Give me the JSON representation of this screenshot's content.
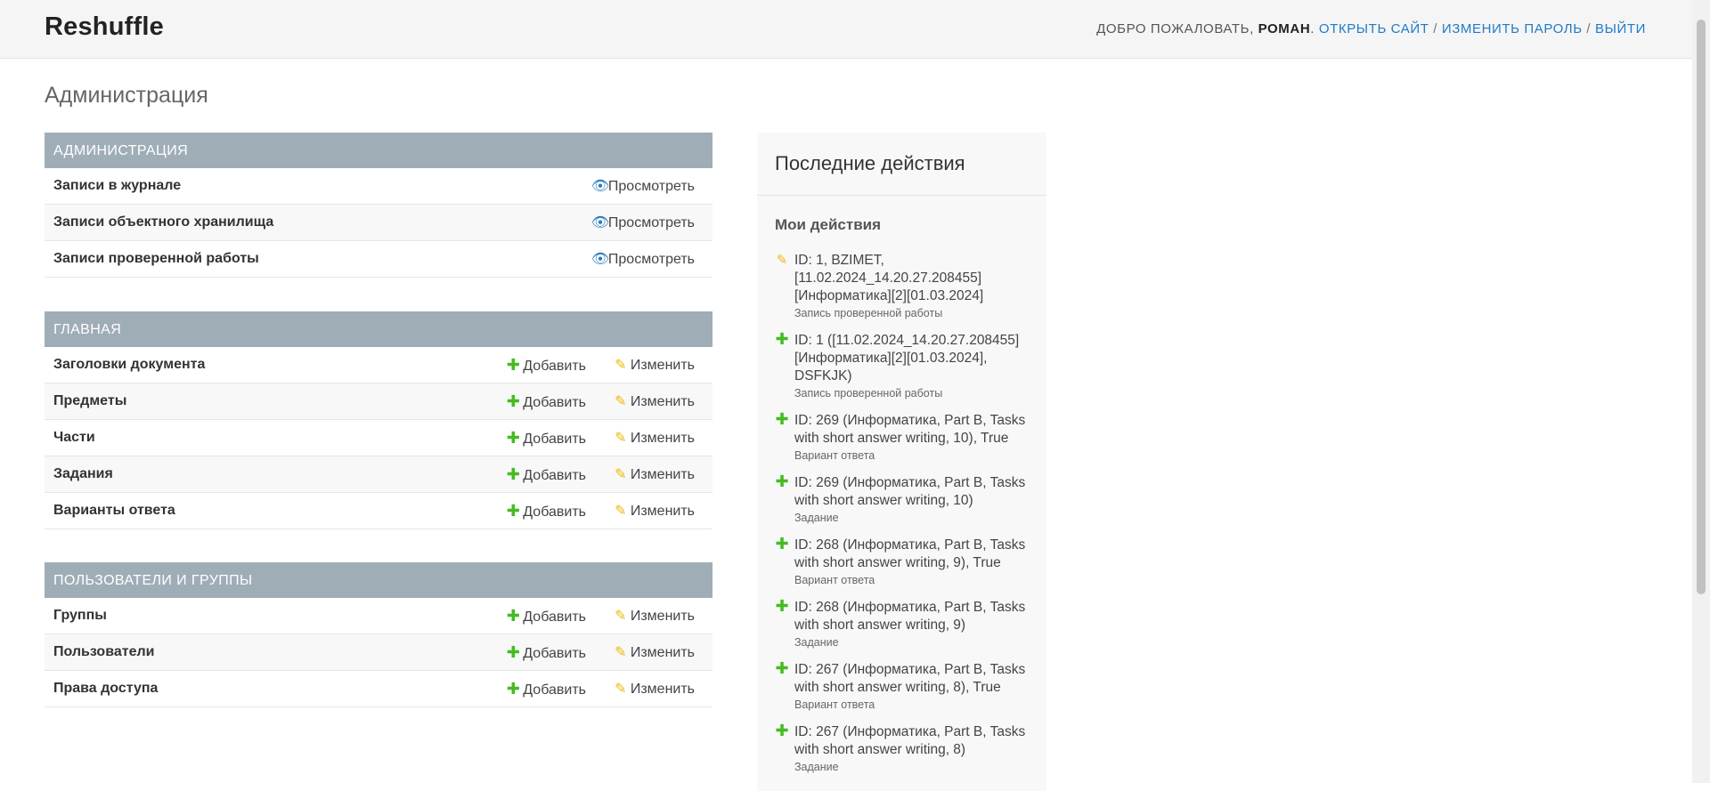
{
  "header": {
    "brand": "Reshuffle",
    "welcome": "Добро пожаловать,",
    "username": "Роман",
    "view_site": "Открыть сайт",
    "change_password": "Изменить пароль",
    "logout": "Выйти",
    "sep": "/"
  },
  "page": {
    "title": "Администрация"
  },
  "modules": [
    {
      "caption": "Администрация",
      "rows": [
        {
          "label": "Записи в журнале",
          "view": "Просмотреть"
        },
        {
          "label": "Записи объектного хранилища",
          "view": "Просмотреть"
        },
        {
          "label": "Записи проверенной работы",
          "view": "Просмотреть"
        }
      ]
    },
    {
      "caption": "Главная",
      "rows": [
        {
          "label": "Заголовки документа",
          "add": "Добавить",
          "change": "Изменить"
        },
        {
          "label": "Предметы",
          "add": "Добавить",
          "change": "Изменить"
        },
        {
          "label": "Части",
          "add": "Добавить",
          "change": "Изменить"
        },
        {
          "label": "Задания",
          "add": "Добавить",
          "change": "Изменить"
        },
        {
          "label": "Варианты ответа",
          "add": "Добавить",
          "change": "Изменить"
        }
      ]
    },
    {
      "caption": "Пользователи и группы",
      "rows": [
        {
          "label": "Группы",
          "add": "Добавить",
          "change": "Изменить"
        },
        {
          "label": "Пользователи",
          "add": "Добавить",
          "change": "Изменить"
        },
        {
          "label": "Права доступа",
          "add": "Добавить",
          "change": "Изменить"
        }
      ]
    }
  ],
  "recent": {
    "title": "Последние действия",
    "subtitle": "Мои действия",
    "actions": [
      {
        "icon": "pencil-icon",
        "text": "ID: 1, BZIMET, [11.02.2024_14.20.27.208455][Информатика][2][01.03.2024]",
        "type": "Запись проверенной работы"
      },
      {
        "icon": "plus-icon",
        "text": "ID: 1 ([11.02.2024_14.20.27.208455][Информатика][2][01.03.2024], DSFKJK)",
        "type": "Запись проверенной работы"
      },
      {
        "icon": "plus-icon",
        "text": "ID: 269 (Информатика, Part B, Tasks with short answer writing, 10), True",
        "type": "Вариант ответа"
      },
      {
        "icon": "plus-icon",
        "text": "ID: 269 (Информатика, Part B, Tasks with short answer writing, 10)",
        "type": "Задание"
      },
      {
        "icon": "plus-icon",
        "text": "ID: 268 (Информатика, Part B, Tasks with short answer writing, 9), True",
        "type": "Вариант ответа"
      },
      {
        "icon": "plus-icon",
        "text": "ID: 268 (Информатика, Part B, Tasks with short answer writing, 9)",
        "type": "Задание"
      },
      {
        "icon": "plus-icon",
        "text": "ID: 267 (Информатика, Part B, Tasks with short answer writing, 8), True",
        "type": "Вариант ответа"
      },
      {
        "icon": "plus-icon",
        "text": "ID: 267 (Информатика, Part B, Tasks with short answer writing, 8)",
        "type": "Задание"
      }
    ]
  },
  "colors": {
    "caption_bg": "#9fadb7",
    "link": "#1f7bc9",
    "add_icon": "#44bb22",
    "change_icon": "#efb80b",
    "view_icon": "#2b7bb9"
  }
}
